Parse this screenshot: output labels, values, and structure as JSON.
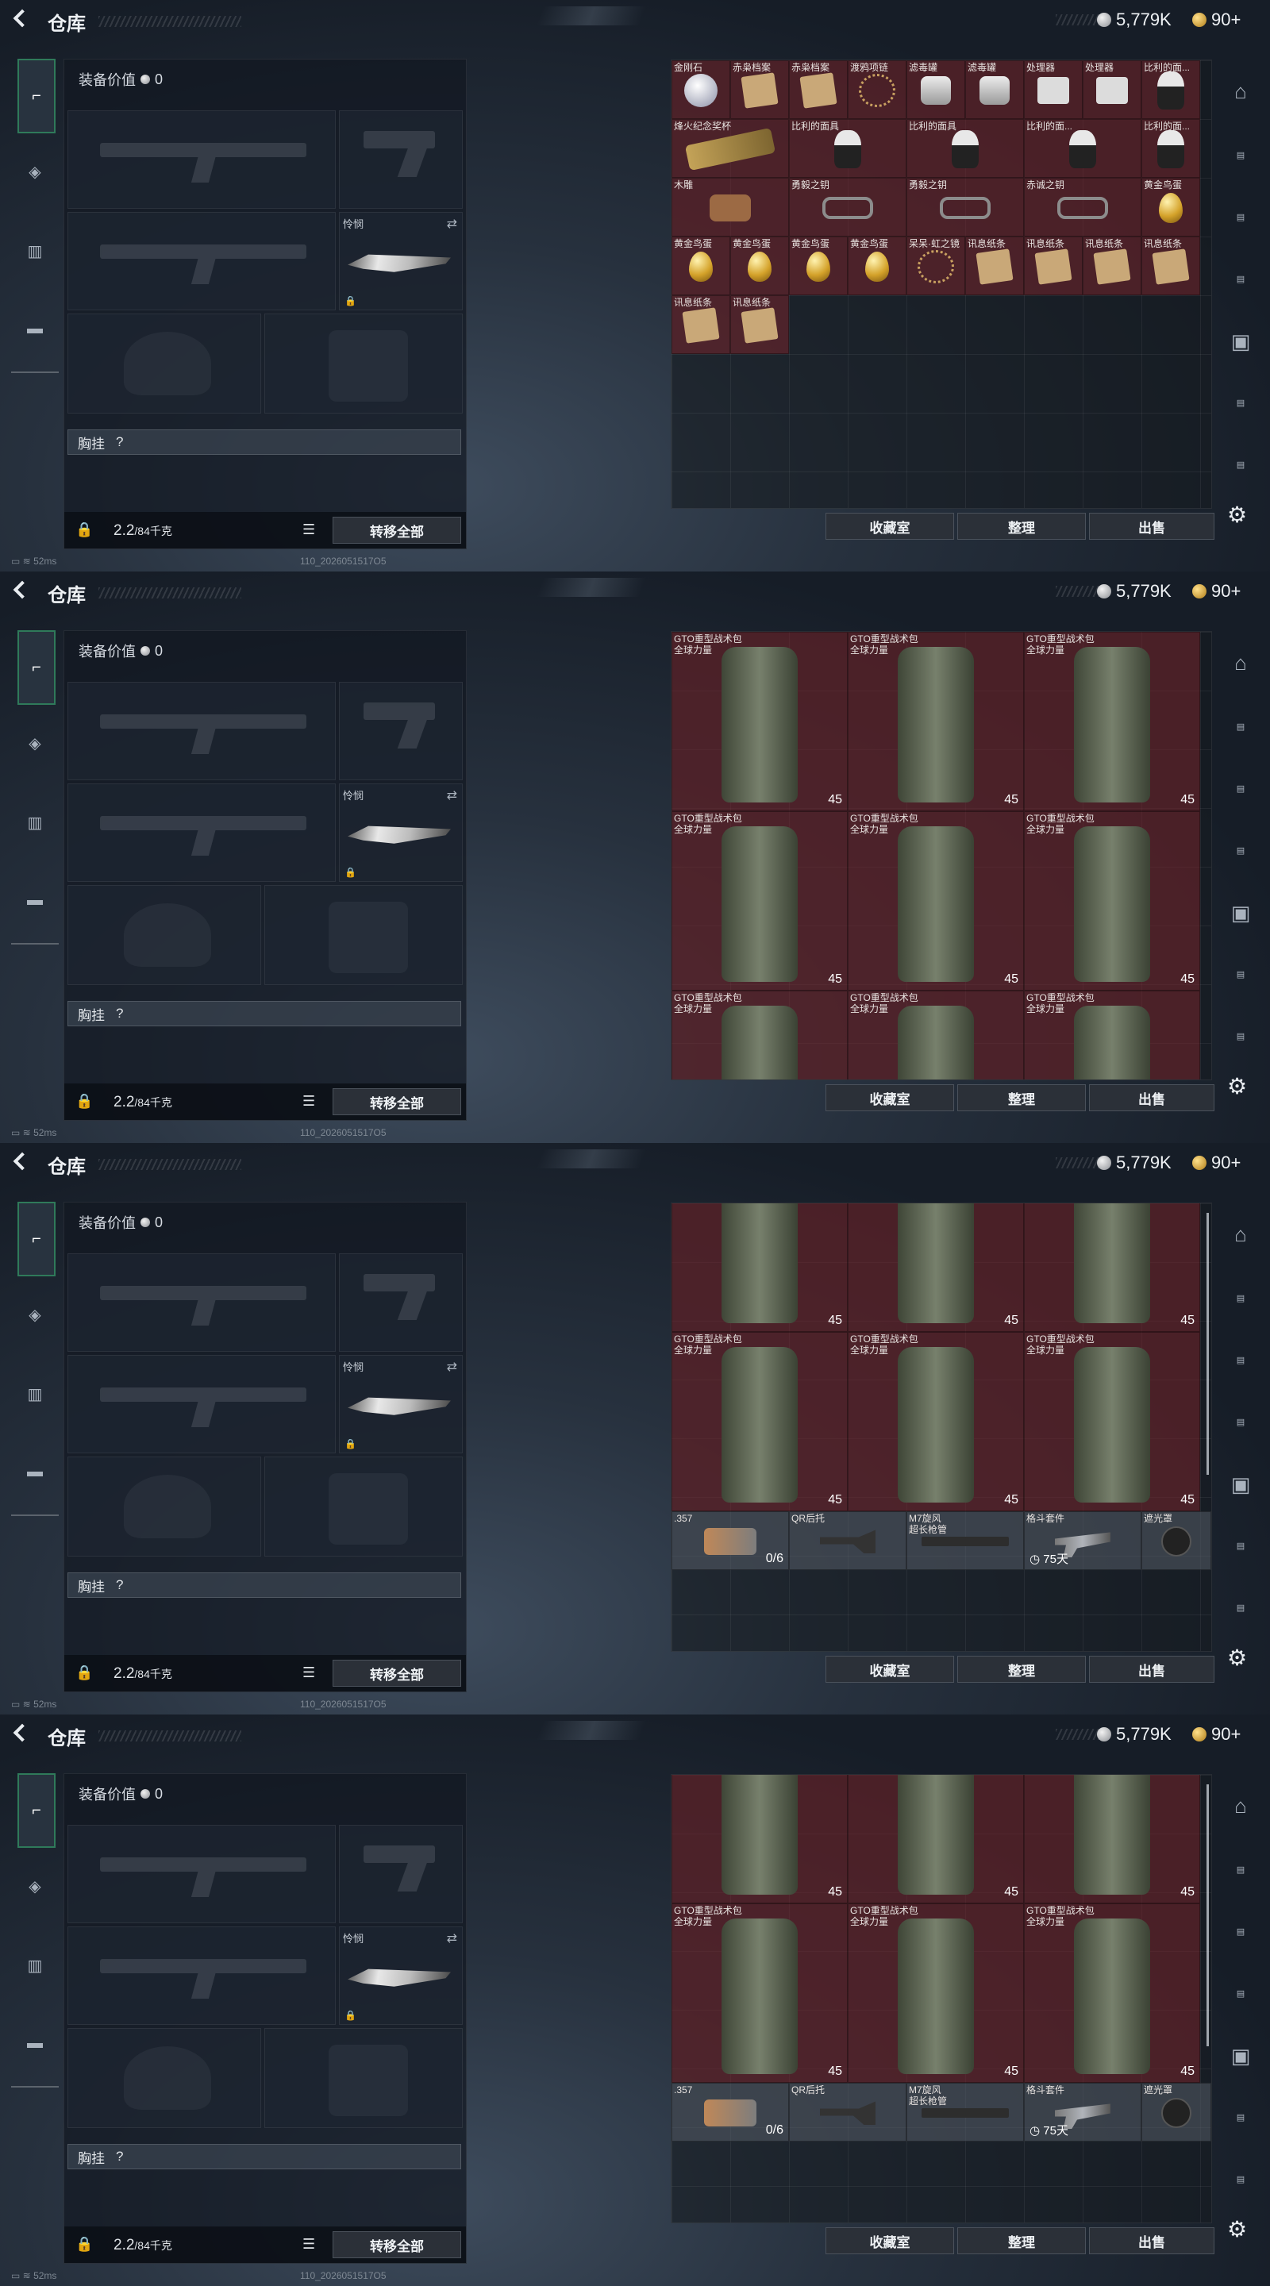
{
  "header": {
    "title": "仓库",
    "silver": "5,779K",
    "gold": "90+"
  },
  "loadout": {
    "equipment_value_label": "装备价值",
    "equipment_value": "0",
    "knife_name": "怜悯",
    "chest_label": "胸挂",
    "chest_hint": "?",
    "weight": "2.2",
    "weight_max": "/84千克",
    "transfer_all": "转移全部"
  },
  "buttons": {
    "collection": "收藏室",
    "arrange": "整理",
    "sell": "出售"
  },
  "status": {
    "ping": "52ms",
    "build": "110_2026051517O5"
  },
  "frame1_items": [
    {
      "label": "金刚石",
      "pic": "gem"
    },
    {
      "label": "赤枭档案",
      "pic": "note"
    },
    {
      "label": "赤枭档案",
      "pic": "note"
    },
    {
      "label": "渡鸦项链",
      "pic": "rope"
    },
    {
      "label": "滤毒罐",
      "pic": "can"
    },
    {
      "label": "滤毒罐",
      "pic": "can"
    },
    {
      "label": "处理器",
      "pic": "dev"
    },
    {
      "label": "处理器",
      "pic": "dev"
    },
    {
      "label": "比利的面...",
      "pic": "doll"
    },
    {
      "label": "烽火纪念奖杯",
      "pic": "trophy"
    },
    {
      "label": "比利的面具",
      "pic": "doll"
    },
    {
      "label": "比利的面具",
      "pic": "doll"
    },
    {
      "label": "比利的面...",
      "pic": "doll"
    },
    {
      "label": "木雕",
      "pic": "wood"
    },
    {
      "label": "勇毅之钥",
      "pic": "key"
    },
    {
      "label": "勇毅之钥",
      "pic": "key"
    },
    {
      "label": "赤诚之钥",
      "pic": "key"
    },
    {
      "label": "黄金鸟蛋",
      "pic": "egg"
    },
    {
      "label": "黄金鸟蛋",
      "pic": "egg"
    },
    {
      "label": "黄金鸟蛋",
      "pic": "egg"
    },
    {
      "label": "黄金鸟蛋",
      "pic": "egg"
    },
    {
      "label": "黄金鸟蛋",
      "pic": "egg"
    },
    {
      "label": "呆呆·虹之镜",
      "pic": "rope"
    },
    {
      "label": "讯息纸条",
      "pic": "note"
    },
    {
      "label": "讯息纸条",
      "pic": "note"
    },
    {
      "label": "讯息纸条",
      "pic": "note"
    },
    {
      "label": "讯息纸条",
      "pic": "note"
    },
    {
      "label": "讯息纸条",
      "pic": "note"
    }
  ],
  "backpack": {
    "label": "GTO重型战术包\n全球力量",
    "count": "45"
  },
  "bottom_items": [
    {
      "label": ".357",
      "label_top": ".357...",
      "count": "0/6",
      "pic": "rev"
    },
    {
      "label": "QR后托",
      "pic": "stock"
    },
    {
      "label": "M7旋风\n超长枪管",
      "pic": "rail"
    },
    {
      "label": "格斗套件",
      "timer": "75天",
      "pic": "kit"
    },
    {
      "label": "遮光罩",
      "pic": "cap"
    }
  ]
}
